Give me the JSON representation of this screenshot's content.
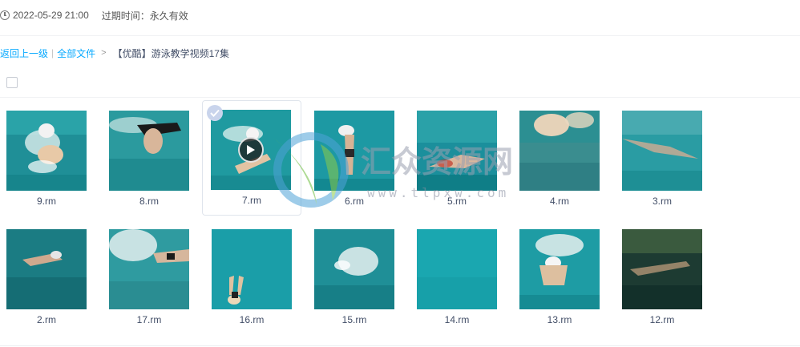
{
  "meta": {
    "date": "2022-05-29 21:00",
    "expire_label": "过期时间：永久有效"
  },
  "breadcrumb": {
    "back": "返回上一级",
    "separator": "|",
    "all_files": "全部文件",
    "arrow": ">",
    "current": "【优酷】游泳教学视频17集"
  },
  "watermark": {
    "name": "汇众资源网",
    "url": "www.tlpxw.com"
  },
  "colors": {
    "link": "#09aaff",
    "pool_water": "#1c9ea6"
  },
  "files": [
    {
      "name": "9.rm"
    },
    {
      "name": "8.rm"
    },
    {
      "name": "7.rm",
      "selected": true,
      "playing_overlay": true
    },
    {
      "name": "6.rm"
    },
    {
      "name": "5.rm"
    },
    {
      "name": "4.rm"
    },
    {
      "name": "3.rm"
    },
    {
      "name": "2.rm"
    },
    {
      "name": "17.rm"
    },
    {
      "name": "16.rm"
    },
    {
      "name": "15.rm"
    },
    {
      "name": "14.rm"
    },
    {
      "name": "13.rm"
    },
    {
      "name": "12.rm"
    }
  ]
}
